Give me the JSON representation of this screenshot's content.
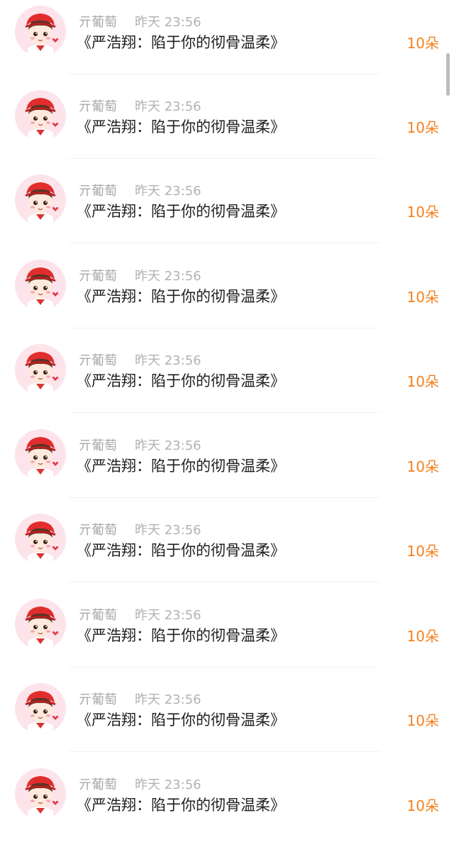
{
  "gift_list": {
    "rows": [
      {
        "name": "亓葡萄",
        "time": "昨天 23:56",
        "title": "《严浩翔：陷于你的彻骨温柔》",
        "amount": "10朵"
      },
      {
        "name": "亓葡萄",
        "time": "昨天 23:56",
        "title": "《严浩翔：陷于你的彻骨温柔》",
        "amount": "10朵"
      },
      {
        "name": "亓葡萄",
        "time": "昨天 23:56",
        "title": "《严浩翔：陷于你的彻骨温柔》",
        "amount": "10朵"
      },
      {
        "name": "亓葡萄",
        "time": "昨天 23:56",
        "title": "《严浩翔：陷于你的彻骨温柔》",
        "amount": "10朵"
      },
      {
        "name": "亓葡萄",
        "time": "昨天 23:56",
        "title": "《严浩翔：陷于你的彻骨温柔》",
        "amount": "10朵"
      },
      {
        "name": "亓葡萄",
        "time": "昨天 23:56",
        "title": "《严浩翔：陷于你的彻骨温柔》",
        "amount": "10朵"
      },
      {
        "name": "亓葡萄",
        "time": "昨天 23:56",
        "title": "《严浩翔：陷于你的彻骨温柔》",
        "amount": "10朵"
      },
      {
        "name": "亓葡萄",
        "time": "昨天 23:56",
        "title": "《严浩翔：陷于你的彻骨温柔》",
        "amount": "10朵"
      },
      {
        "name": "亓葡萄",
        "time": "昨天 23:56",
        "title": "《严浩翔：陷于你的彻骨温柔》",
        "amount": "10朵"
      },
      {
        "name": "亓葡萄",
        "time": "昨天 23:56",
        "title": "《严浩翔：陷于你的彻骨温柔》",
        "amount": "10朵"
      }
    ]
  },
  "colors": {
    "amount": "#f5801e",
    "name": "#a8a8a8",
    "title": "#1e1e1e",
    "avatar_bg": "#fde3ea"
  },
  "icons": {
    "avatar": "cartoon-boy-red-cap-avatar"
  }
}
